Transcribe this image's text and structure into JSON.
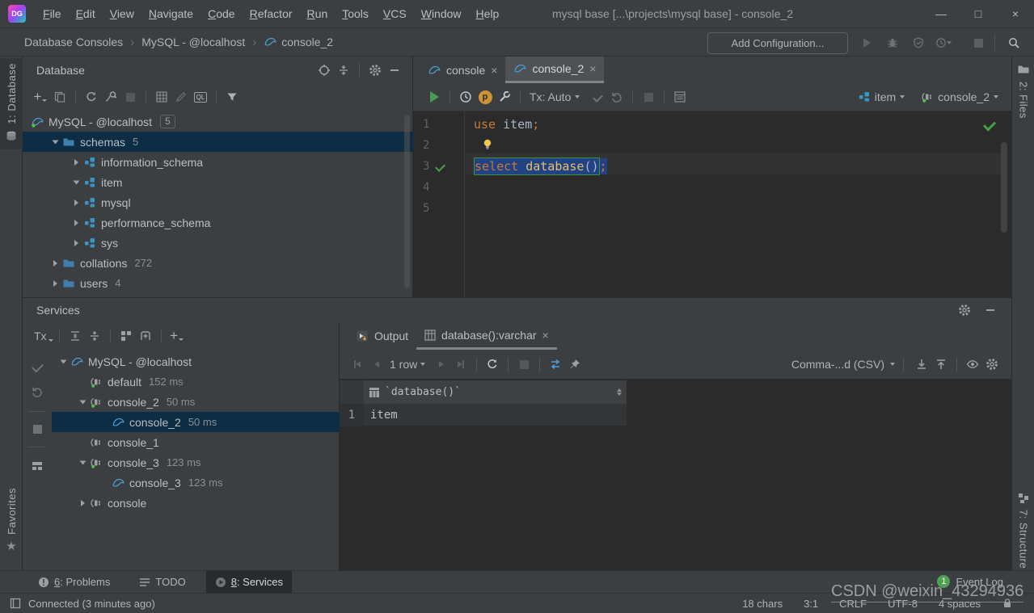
{
  "icons": {
    "logo": "DG",
    "ql": "QL",
    "p_badge": "p",
    "close": "×",
    "min": "—",
    "max": "□",
    "crumb_sep": "›"
  },
  "titlebar": {
    "title": "mysql base [...\\projects\\mysql base] - console_2",
    "menu_items": [
      "File",
      "Edit",
      "View",
      "Navigate",
      "Code",
      "Refactor",
      "Run",
      "Tools",
      "VCS",
      "Window",
      "Help"
    ]
  },
  "navbar": {
    "breadcrumbs": [
      "Database Consoles",
      "MySQL - @localhost",
      "console_2"
    ],
    "add_configuration": "Add Configuration..."
  },
  "stripes": {
    "database": "1: Database",
    "favorites": "Favorites",
    "files": "2: Files",
    "structure": "7: Structure"
  },
  "db": {
    "title": "Database",
    "tree": [
      {
        "label": "MySQL - @localhost",
        "badge": "5"
      },
      {
        "label": "schemas",
        "count": "5"
      },
      {
        "label": "information_schema"
      },
      {
        "label": "item"
      },
      {
        "label": "mysql"
      },
      {
        "label": "performance_schema"
      },
      {
        "label": "sys"
      },
      {
        "label": "collations",
        "count": "272"
      },
      {
        "label": "users",
        "count": "4"
      }
    ]
  },
  "editor": {
    "tabs": [
      {
        "label": "console"
      },
      {
        "label": "console_2"
      }
    ],
    "toolbar": {
      "tx": "Tx: Auto",
      "schema": "item",
      "session": "console_2"
    },
    "lines": [
      "1",
      "2",
      "3",
      "4",
      "5"
    ],
    "code": {
      "kw_use": "use",
      "id_item": " item",
      "semi1": ";",
      "kw_select": "select",
      "fn_database": " database",
      "parens": "()",
      "semi2": ";"
    }
  },
  "services": {
    "title": "Services",
    "tx": "Tx",
    "tree": [
      {
        "label": "MySQL - @localhost"
      },
      {
        "label": "default",
        "time": "152 ms"
      },
      {
        "label": "console_2",
        "time": "50 ms"
      },
      {
        "label": "console_2",
        "time": "50 ms"
      },
      {
        "label": "console_1"
      },
      {
        "label": "console_3",
        "time": "123 ms"
      },
      {
        "label": "console_3",
        "time": "123 ms"
      },
      {
        "label": "console"
      }
    ]
  },
  "output": {
    "tabs": [
      {
        "label": "Output"
      },
      {
        "label": "database():varchar"
      }
    ],
    "pager": "1 row",
    "format": "Comma-...d (CSV)",
    "table": {
      "header": "`database()`",
      "rows": [
        {
          "num": "1",
          "value": "item"
        }
      ]
    }
  },
  "bottom": {
    "problems_num": "6",
    "problems_rest": ": Problems",
    "todo": "TODO",
    "services_num": "8",
    "services_rest": ": Services",
    "event_badge": "1",
    "event_log": "Event Log"
  },
  "status": {
    "connected": "Connected (3 minutes ago)",
    "chars": "18 chars",
    "caret": "3:1",
    "line_sep": "CRLF",
    "encoding": "UTF-8",
    "indent": "4 spaces"
  },
  "watermark": "CSDN @weixin_43294936",
  "colors": {
    "panel_bg": "#3c3f41",
    "editor_bg": "#2b2b2b",
    "selected_row": "#0c2d44",
    "editor_selection": "#214283",
    "statement_border": "#3e8e41",
    "keyword": "#cc7832",
    "function": "#e8bf6a",
    "plain": "#a9b7c6",
    "green": "#499c54",
    "active_tab": "#4e5254"
  }
}
